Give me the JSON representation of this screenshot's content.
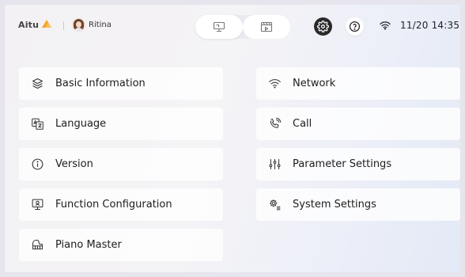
{
  "header": {
    "brand": "Aitu",
    "user_name": "Ritina",
    "clock": "11/20 14:35"
  },
  "menu": {
    "left": [
      {
        "label": "Basic Information",
        "icon": "layers-icon"
      },
      {
        "label": "Language",
        "icon": "translate-icon"
      },
      {
        "label": "Version",
        "icon": "info-icon"
      },
      {
        "label": "Function Configuration",
        "icon": "screen-config-icon"
      },
      {
        "label": "Piano Master",
        "icon": "piano-icon"
      }
    ],
    "right": [
      {
        "label": "Network",
        "icon": "wifi-icon"
      },
      {
        "label": "Call",
        "icon": "phone-call-icon"
      },
      {
        "label": "Parameter Settings",
        "icon": "sliders-icon"
      },
      {
        "label": "System Settings",
        "icon": "system-settings-icon"
      }
    ]
  },
  "colors": {
    "accent": "#f5a623",
    "gear_bg": "#2a2a2a"
  }
}
